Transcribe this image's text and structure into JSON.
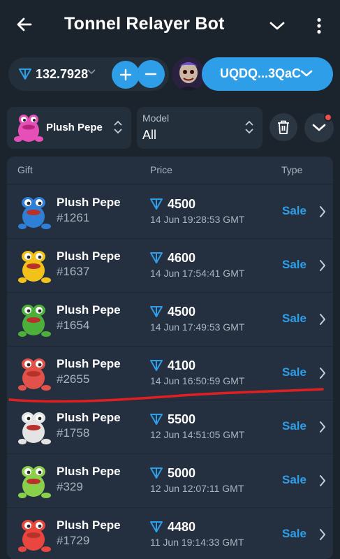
{
  "header": {
    "title": "Tonnel Relayer Bot"
  },
  "wallet": {
    "balance": "132.7928",
    "address_short": "UQDQ...3QaC"
  },
  "filters": {
    "gift": "Plush Pepe",
    "model_caption": "Model",
    "model_value": "All"
  },
  "table": {
    "headers": {
      "gift": "Gift",
      "price": "Price",
      "type": "Type"
    },
    "rows": [
      {
        "name": "Plush Pepe",
        "number": "#1261",
        "price": "4500",
        "date": "14 Jun 19:28:53 GMT",
        "type": "Sale",
        "color": "#2f7fd6"
      },
      {
        "name": "Plush Pepe",
        "number": "#1637",
        "price": "4600",
        "date": "14 Jun 17:54:41 GMT",
        "type": "Sale",
        "color": "#f2c21a"
      },
      {
        "name": "Plush Pepe",
        "number": "#1654",
        "price": "4500",
        "date": "14 Jun 17:49:53 GMT",
        "type": "Sale",
        "color": "#4caf3a"
      },
      {
        "name": "Plush Pepe",
        "number": "#2655",
        "price": "4100",
        "date": "14 Jun 16:50:59 GMT",
        "type": "Sale",
        "color": "#e2524a"
      },
      {
        "name": "Plush Pepe",
        "number": "#1758",
        "price": "5500",
        "date": "12 Jun 14:51:05 GMT",
        "type": "Sale",
        "color": "#e4e4e4"
      },
      {
        "name": "Plush Pepe",
        "number": "#329",
        "price": "5000",
        "date": "12 Jun 12:07:11 GMT",
        "type": "Sale",
        "color": "#8ad04a"
      },
      {
        "name": "Plush Pepe",
        "number": "#1729",
        "price": "4480",
        "date": "11 Jun 19:14:33 GMT",
        "type": "Sale",
        "color": "#e8463e"
      }
    ]
  },
  "colors": {
    "background": "#1b232d",
    "card": "#242f3c",
    "accent": "#2f9ee8",
    "annotation": "#e02020"
  },
  "icons": [
    "back-arrow-icon",
    "chevron-down-icon",
    "more-vertical-icon",
    "ton-icon",
    "plus-icon",
    "minus-icon",
    "updown-icon",
    "trash-icon",
    "chevron-right-icon"
  ]
}
